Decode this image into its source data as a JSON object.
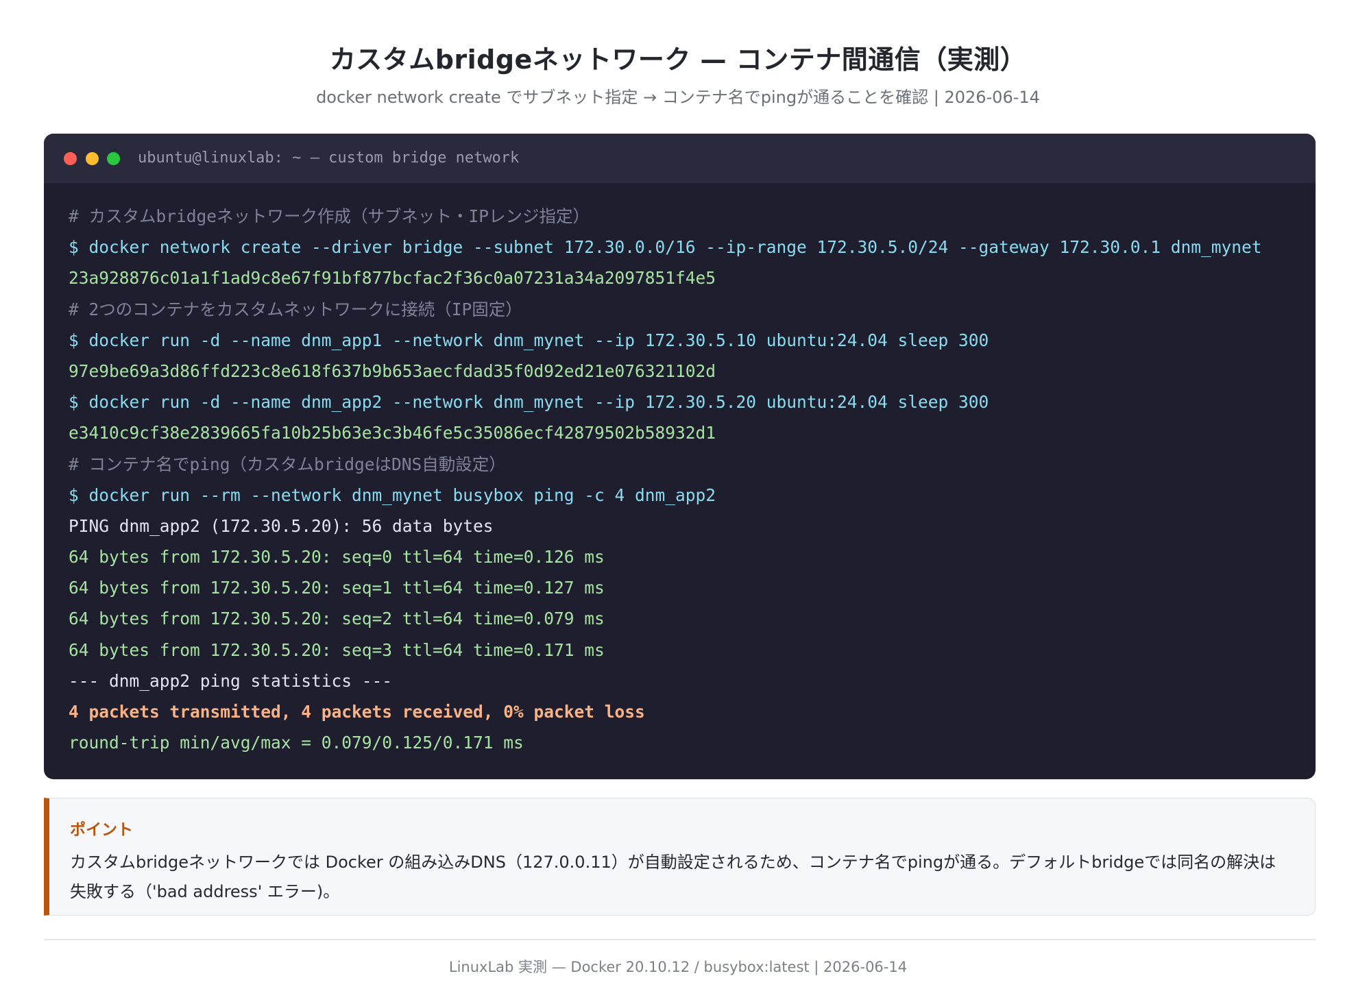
{
  "header": {
    "title": "カスタムbridgeネットワーク — コンテナ間通信（実測）",
    "subtitle": "docker network create でサブネット指定 → コンテナ名でpingが通ることを確認 | 2026-06-14"
  },
  "terminal": {
    "window_title": "ubuntu@linuxlab: ~ — custom bridge network",
    "lines": [
      {
        "kind": "comment",
        "text": "# カスタムbridgeネットワーク作成（サブネット・IPレンジ指定）"
      },
      {
        "kind": "cmd",
        "text": "$ docker network create --driver bridge --subnet 172.30.0.0/16 --ip-range 172.30.5.0/24 --gateway 172.30.0.1 dnm_mynet"
      },
      {
        "kind": "ok",
        "text": "23a928876c01a1f1ad9c8e67f91bf877bcfac2f36c0a07231a34a2097851f4e5"
      },
      {
        "kind": "comment",
        "text": "# 2つのコンテナをカスタムネットワークに接続（IP固定）"
      },
      {
        "kind": "cmd",
        "text": "$ docker run -d --name dnm_app1 --network dnm_mynet --ip 172.30.5.10 ubuntu:24.04 sleep 300"
      },
      {
        "kind": "ok",
        "text": "97e9be69a3d86ffd223c8e618f637b9b653aecfdad35f0d92ed21e076321102d"
      },
      {
        "kind": "cmd",
        "text": "$ docker run -d --name dnm_app2 --network dnm_mynet --ip 172.30.5.20 ubuntu:24.04 sleep 300"
      },
      {
        "kind": "ok",
        "text": "e3410c9cf38e2839665fa10b25b63e3c3b46fe5c35086ecf42879502b58932d1"
      },
      {
        "kind": "comment",
        "text": "# コンテナ名でping（カスタムbridgeはDNS自動設定）"
      },
      {
        "kind": "cmd",
        "text": "$ docker run --rm --network dnm_mynet busybox ping -c 4 dnm_app2"
      },
      {
        "kind": "plain",
        "text": "PING dnm_app2 (172.30.5.20): 56 data bytes"
      },
      {
        "kind": "ok",
        "text": "64 bytes from 172.30.5.20: seq=0 ttl=64 time=0.126 ms"
      },
      {
        "kind": "ok",
        "text": "64 bytes from 172.30.5.20: seq=1 ttl=64 time=0.127 ms"
      },
      {
        "kind": "ok",
        "text": "64 bytes from 172.30.5.20: seq=2 ttl=64 time=0.079 ms"
      },
      {
        "kind": "ok",
        "text": "64 bytes from 172.30.5.20: seq=3 ttl=64 time=0.171 ms"
      },
      {
        "kind": "plain",
        "text": "--- dnm_app2 ping statistics ---"
      },
      {
        "kind": "warn",
        "text": "4 packets transmitted, 4 packets received, 0% packet loss"
      },
      {
        "kind": "ok",
        "text": "round-trip min/avg/max = 0.079/0.125/0.171 ms"
      }
    ],
    "colors": {
      "background": "#1e1e2e",
      "titlebar": "#2a2a3d",
      "comment": "#7f8296",
      "cmd": "#89dcf0",
      "ok": "#a6e3a1",
      "plain": "#e2e4f0",
      "warn": "#fab387",
      "dot_red": "#ff5f57",
      "dot_yellow": "#febc2e",
      "dot_green": "#28c840"
    }
  },
  "note": {
    "title": "ポイント",
    "text": "カスタムbridgeネットワークでは Docker の組み込みDNS（127.0.0.11）が自動設定されるため、コンテナ名でpingが通る。デフォルトbridgeでは同名の解決は失敗する（'bad address' エラー)。",
    "accent_color": "#b8560f"
  },
  "footer": {
    "text": "LinuxLab 実測 — Docker 20.10.12 / busybox:latest | 2026-06-14"
  }
}
